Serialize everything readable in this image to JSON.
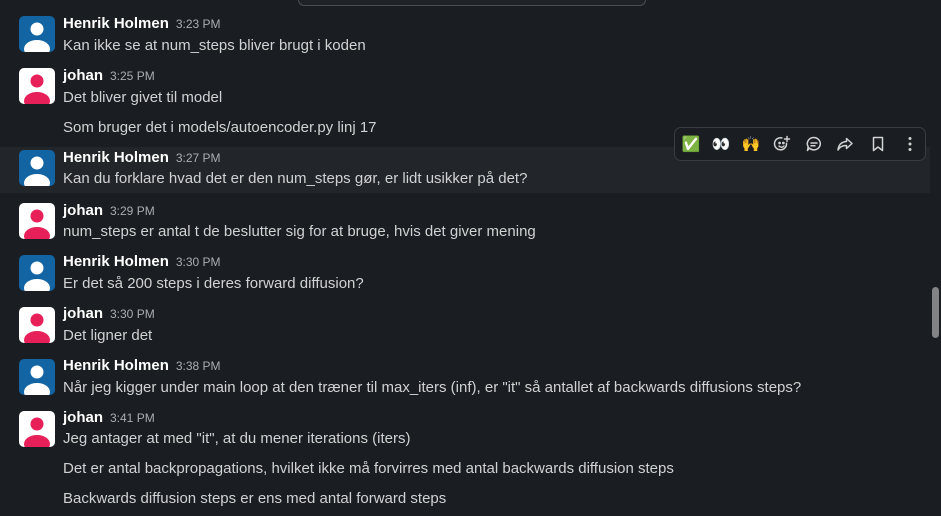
{
  "messages": [
    {
      "author": "Henrik Holmen",
      "time": "3:23 PM",
      "lines": [
        "Kan ikke se at num_steps bliver brugt i koden"
      ]
    },
    {
      "author": "johan",
      "time": "3:25 PM",
      "lines": [
        "Det bliver givet til model",
        "Som bruger det i models/autoencoder.py linj 17"
      ]
    },
    {
      "author": "Henrik Holmen",
      "time": "3:27 PM",
      "lines": [
        "Kan du forklare hvad det er den num_steps gør, er lidt usikker på det?"
      ]
    },
    {
      "author": "johan",
      "time": "3:29 PM",
      "lines": [
        "num_steps er antal t de beslutter sig for at bruge, hvis det giver mening"
      ]
    },
    {
      "author": "Henrik Holmen",
      "time": "3:30 PM",
      "lines": [
        "Er det så 200 steps i deres forward diffusion?"
      ]
    },
    {
      "author": "johan",
      "time": "3:30 PM",
      "lines": [
        "Det ligner det"
      ]
    },
    {
      "author": "Henrik Holmen",
      "time": "3:38 PM",
      "lines": [
        "Når jeg kigger under main loop at den træner til max_iters (inf), er \"it\" så antallet af backwards diffusions steps?"
      ]
    },
    {
      "author": "johan",
      "time": "3:41 PM",
      "lines": [
        "Jeg antager at med \"it\", at du mener iterations (iters)",
        "Det er antal backpropagations, hvilket ikke må forvirres med antal backwards diffusion steps",
        "Backwards diffusion steps er ens med antal forward steps"
      ]
    }
  ],
  "toolbar": {
    "items": [
      {
        "icon": "white-check-mark-emoji",
        "glyph": "✅"
      },
      {
        "icon": "eyes-emoji",
        "glyph": "👀"
      },
      {
        "icon": "raised-hands-emoji",
        "glyph": "🙌"
      },
      {
        "icon": "add-reaction-icon",
        "glyph": ""
      },
      {
        "icon": "reply-in-thread-icon",
        "glyph": ""
      },
      {
        "icon": "forward-message-icon",
        "glyph": ""
      },
      {
        "icon": "save-for-later-icon",
        "glyph": ""
      },
      {
        "icon": "more-actions-icon",
        "glyph": ""
      }
    ]
  },
  "colors": {
    "background": "#1a1d21",
    "hover_row": "#222529",
    "henrik_avatar": "#1264a3",
    "johan_avatar": "#e8205a",
    "text": "#d1d2d3",
    "name": "#ffffff",
    "timestamp": "#abadaf"
  }
}
